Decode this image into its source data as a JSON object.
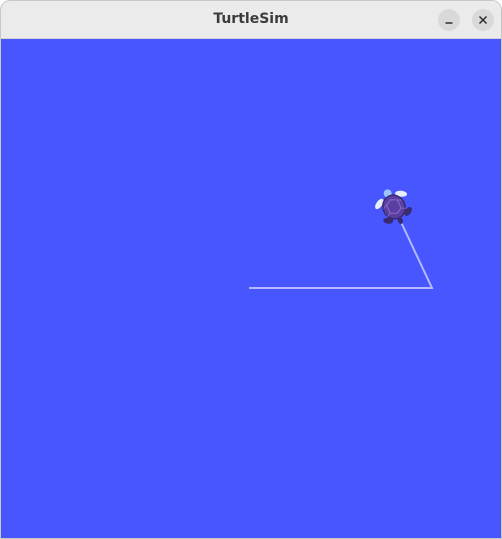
{
  "window": {
    "title": "TurtleSim",
    "buttons": [
      {
        "name": "minimize",
        "icon": "minimize-icon"
      },
      {
        "name": "close",
        "icon": "close-icon"
      }
    ]
  },
  "canvas": {
    "background_color": "#4756ff",
    "pen_color": "#b3b8ff",
    "turtle_color": "#5b3fa0",
    "turtle_icon": "turtle-icon"
  }
}
